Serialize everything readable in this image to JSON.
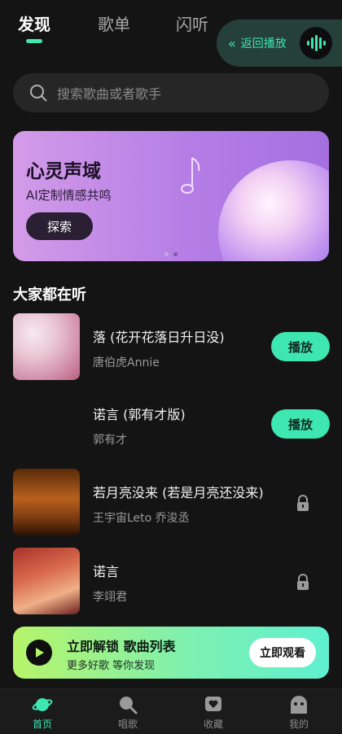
{
  "tabs": [
    "发现",
    "歌单",
    "闪听"
  ],
  "return_play": {
    "label": "返回播放"
  },
  "search": {
    "placeholder": "搜索歌曲或者歌手"
  },
  "banner": {
    "title": "心灵声域",
    "subtitle": "AI定制情感共鸣",
    "button": "探索"
  },
  "section_title": "大家都在听",
  "songs": [
    {
      "title": "落 (花开花落日升日没)",
      "artist": "唐伯虎Annie",
      "action": "播放"
    },
    {
      "title": "诺言 (郭有才版)",
      "artist": "郭有才",
      "action": "播放"
    },
    {
      "title": "若月亮没来 (若是月亮还没来)",
      "artist": "王宇宙Leto 乔浚丞"
    },
    {
      "title": "诺言",
      "artist": "李翊君"
    }
  ],
  "unlock": {
    "title": "立即解锁 歌曲列表",
    "subtitle": "更多好歌 等你发现",
    "button": "立即观看"
  },
  "nav": [
    "首页",
    "唱歌",
    "收藏",
    "我的"
  ],
  "colors": {
    "accent": "#3ee6b0",
    "background": "#141414"
  }
}
